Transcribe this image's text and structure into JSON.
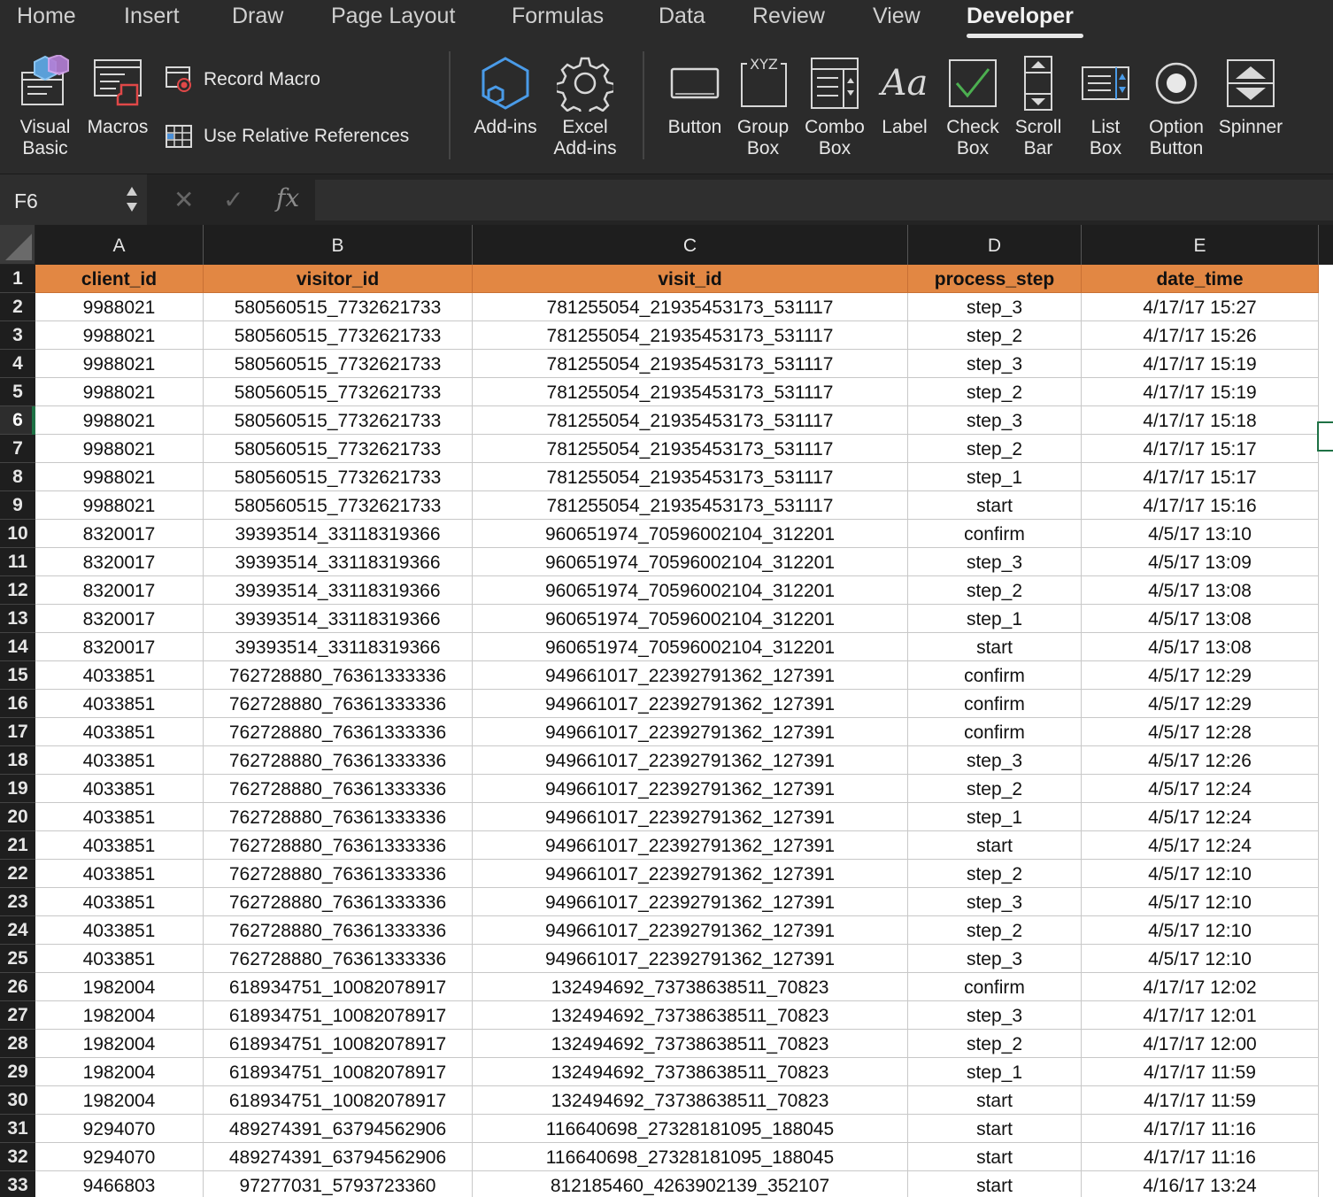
{
  "tabs": [
    {
      "label": "Home"
    },
    {
      "label": "Insert"
    },
    {
      "label": "Draw"
    },
    {
      "label": "Page Layout"
    },
    {
      "label": "Formulas"
    },
    {
      "label": "Data"
    },
    {
      "label": "Review"
    },
    {
      "label": "View"
    },
    {
      "label": "Developer",
      "active": true
    }
  ],
  "ribbon": {
    "visual_basic": "Visual\nBasic",
    "macros": "Macros",
    "record_macro": "Record Macro",
    "use_relative_references": "Use Relative References",
    "add_ins": "Add-ins",
    "excel_add_ins": "Excel\nAdd-ins",
    "button": "Button",
    "group_box": "Group\nBox",
    "group_box_icon_text": "XYZ",
    "combo_box": "Combo\nBox",
    "label": "Label",
    "label_icon_text": "Aa",
    "check_box": "Check\nBox",
    "scroll_bar": "Scroll\nBar",
    "list_box": "List\nBox",
    "option_button": "Option\nButton",
    "spinner": "Spinner"
  },
  "formula_bar": {
    "name_box": "F6",
    "formula": ""
  },
  "columns": [
    "A",
    "B",
    "C",
    "D",
    "E"
  ],
  "selected_row": 6,
  "header_row": [
    "client_id",
    "visitor_id",
    "visit_id",
    "process_step",
    "date_time"
  ],
  "rows": [
    [
      "9988021",
      "580560515_7732621733",
      "781255054_21935453173_531117",
      "step_3",
      "4/17/17 15:27"
    ],
    [
      "9988021",
      "580560515_7732621733",
      "781255054_21935453173_531117",
      "step_2",
      "4/17/17 15:26"
    ],
    [
      "9988021",
      "580560515_7732621733",
      "781255054_21935453173_531117",
      "step_3",
      "4/17/17 15:19"
    ],
    [
      "9988021",
      "580560515_7732621733",
      "781255054_21935453173_531117",
      "step_2",
      "4/17/17 15:19"
    ],
    [
      "9988021",
      "580560515_7732621733",
      "781255054_21935453173_531117",
      "step_3",
      "4/17/17 15:18"
    ],
    [
      "9988021",
      "580560515_7732621733",
      "781255054_21935453173_531117",
      "step_2",
      "4/17/17 15:17"
    ],
    [
      "9988021",
      "580560515_7732621733",
      "781255054_21935453173_531117",
      "step_1",
      "4/17/17 15:17"
    ],
    [
      "9988021",
      "580560515_7732621733",
      "781255054_21935453173_531117",
      "start",
      "4/17/17 15:16"
    ],
    [
      "8320017",
      "39393514_33118319366",
      "960651974_70596002104_312201",
      "confirm",
      "4/5/17 13:10"
    ],
    [
      "8320017",
      "39393514_33118319366",
      "960651974_70596002104_312201",
      "step_3",
      "4/5/17 13:09"
    ],
    [
      "8320017",
      "39393514_33118319366",
      "960651974_70596002104_312201",
      "step_2",
      "4/5/17 13:08"
    ],
    [
      "8320017",
      "39393514_33118319366",
      "960651974_70596002104_312201",
      "step_1",
      "4/5/17 13:08"
    ],
    [
      "8320017",
      "39393514_33118319366",
      "960651974_70596002104_312201",
      "start",
      "4/5/17 13:08"
    ],
    [
      "4033851",
      "762728880_76361333336",
      "949661017_22392791362_127391",
      "confirm",
      "4/5/17 12:29"
    ],
    [
      "4033851",
      "762728880_76361333336",
      "949661017_22392791362_127391",
      "confirm",
      "4/5/17 12:29"
    ],
    [
      "4033851",
      "762728880_76361333336",
      "949661017_22392791362_127391",
      "confirm",
      "4/5/17 12:28"
    ],
    [
      "4033851",
      "762728880_76361333336",
      "949661017_22392791362_127391",
      "step_3",
      "4/5/17 12:26"
    ],
    [
      "4033851",
      "762728880_76361333336",
      "949661017_22392791362_127391",
      "step_2",
      "4/5/17 12:24"
    ],
    [
      "4033851",
      "762728880_76361333336",
      "949661017_22392791362_127391",
      "step_1",
      "4/5/17 12:24"
    ],
    [
      "4033851",
      "762728880_76361333336",
      "949661017_22392791362_127391",
      "start",
      "4/5/17 12:24"
    ],
    [
      "4033851",
      "762728880_76361333336",
      "949661017_22392791362_127391",
      "step_2",
      "4/5/17 12:10"
    ],
    [
      "4033851",
      "762728880_76361333336",
      "949661017_22392791362_127391",
      "step_3",
      "4/5/17 12:10"
    ],
    [
      "4033851",
      "762728880_76361333336",
      "949661017_22392791362_127391",
      "step_2",
      "4/5/17 12:10"
    ],
    [
      "4033851",
      "762728880_76361333336",
      "949661017_22392791362_127391",
      "step_3",
      "4/5/17 12:10"
    ],
    [
      "1982004",
      "618934751_10082078917",
      "132494692_73738638511_70823",
      "confirm",
      "4/17/17 12:02"
    ],
    [
      "1982004",
      "618934751_10082078917",
      "132494692_73738638511_70823",
      "step_3",
      "4/17/17 12:01"
    ],
    [
      "1982004",
      "618934751_10082078917",
      "132494692_73738638511_70823",
      "step_2",
      "4/17/17 12:00"
    ],
    [
      "1982004",
      "618934751_10082078917",
      "132494692_73738638511_70823",
      "step_1",
      "4/17/17 11:59"
    ],
    [
      "1982004",
      "618934751_10082078917",
      "132494692_73738638511_70823",
      "start",
      "4/17/17 11:59"
    ],
    [
      "9294070",
      "489274391_63794562906",
      "116640698_27328181095_188045",
      "start",
      "4/17/17 11:16"
    ],
    [
      "9294070",
      "489274391_63794562906",
      "116640698_27328181095_188045",
      "start",
      "4/17/17 11:16"
    ],
    [
      "9466803",
      "97277031_5793723360",
      "812185460_4263902139_352107",
      "start",
      "4/16/17 13:24"
    ]
  ],
  "colors": {
    "header_fill": "#e28743",
    "selection": "#1e7145",
    "ribbon_bg": "#2b2b2b"
  }
}
